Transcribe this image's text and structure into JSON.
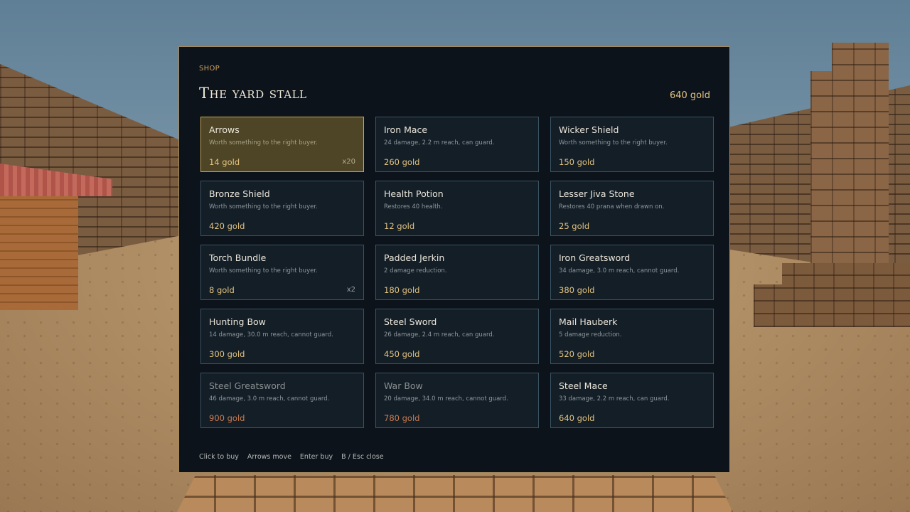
{
  "shop": {
    "label": "SHOP",
    "title": "The yard stall",
    "gold_total": "640 gold"
  },
  "colors": {
    "accent_gold": "#e4c380",
    "panel_bg": "#0c131a",
    "card_border": "#3b5362",
    "selected_bg": "#4e4526",
    "unaffordable_price": "#c97a50"
  },
  "items": [
    {
      "name": "Arrows",
      "desc": "Worth something to the right buyer.",
      "price": "14 gold",
      "qty": "x20",
      "selected": true,
      "affordable": true
    },
    {
      "name": "Iron Mace",
      "desc": "24 damage, 2.2 m reach, can guard.",
      "price": "260 gold",
      "qty": "",
      "selected": false,
      "affordable": true
    },
    {
      "name": "Wicker Shield",
      "desc": "Worth something to the right buyer.",
      "price": "150 gold",
      "qty": "",
      "selected": false,
      "affordable": true
    },
    {
      "name": "Bronze Shield",
      "desc": "Worth something to the right buyer.",
      "price": "420 gold",
      "qty": "",
      "selected": false,
      "affordable": true
    },
    {
      "name": "Health Potion",
      "desc": "Restores 40 health.",
      "price": "12 gold",
      "qty": "",
      "selected": false,
      "affordable": true
    },
    {
      "name": "Lesser Jiva Stone",
      "desc": "Restores 40 prana when drawn on.",
      "price": "25 gold",
      "qty": "",
      "selected": false,
      "affordable": true
    },
    {
      "name": "Torch Bundle",
      "desc": "Worth something to the right buyer.",
      "price": "8 gold",
      "qty": "x2",
      "selected": false,
      "affordable": true
    },
    {
      "name": "Padded Jerkin",
      "desc": "2 damage reduction.",
      "price": "180 gold",
      "qty": "",
      "selected": false,
      "affordable": true
    },
    {
      "name": "Iron Greatsword",
      "desc": "34 damage, 3.0 m reach, cannot guard.",
      "price": "380 gold",
      "qty": "",
      "selected": false,
      "affordable": true
    },
    {
      "name": "Hunting Bow",
      "desc": "14 damage, 30.0 m reach, cannot guard.",
      "price": "300 gold",
      "qty": "",
      "selected": false,
      "affordable": true
    },
    {
      "name": "Steel Sword",
      "desc": "26 damage, 2.4 m reach, can guard.",
      "price": "450 gold",
      "qty": "",
      "selected": false,
      "affordable": true
    },
    {
      "name": "Mail Hauberk",
      "desc": "5 damage reduction.",
      "price": "520 gold",
      "qty": "",
      "selected": false,
      "affordable": true
    },
    {
      "name": "Steel Greatsword",
      "desc": "46 damage, 3.0 m reach, cannot guard.",
      "price": "900 gold",
      "qty": "",
      "selected": false,
      "affordable": false
    },
    {
      "name": "War Bow",
      "desc": "20 damage, 34.0 m reach, cannot guard.",
      "price": "780 gold",
      "qty": "",
      "selected": false,
      "affordable": false
    },
    {
      "name": "Steel Mace",
      "desc": "33 damage, 2.2 m reach, can guard.",
      "price": "640 gold",
      "qty": "",
      "selected": false,
      "affordable": true
    }
  ],
  "hints": [
    "Click to buy",
    "Arrows move",
    "Enter buy",
    "B / Esc close"
  ]
}
